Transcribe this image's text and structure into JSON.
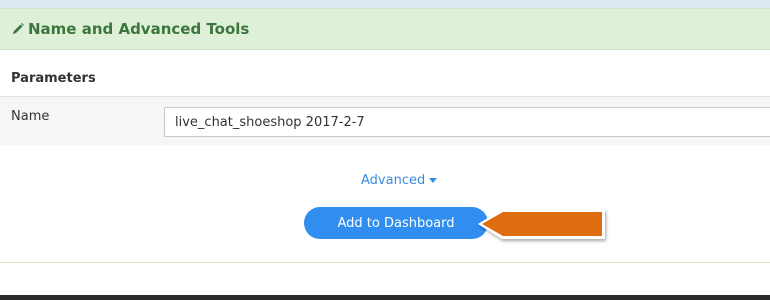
{
  "section": {
    "title": "Name and Advanced Tools",
    "icon": "pencil-icon"
  },
  "parameters": {
    "heading": "Parameters",
    "name_label": "Name",
    "name_value": "live_chat_shoeshop 2017-2-7"
  },
  "advanced": {
    "label": "Advanced",
    "icon": "caret-down-icon"
  },
  "actions": {
    "add_to_dashboard_label": "Add to Dashboard"
  },
  "colors": {
    "header_bg": "#dff0d8",
    "header_text": "#3c763d",
    "link": "#3a8be0",
    "primary_button": "#2f8ef0",
    "callout_arrow": "#e06c10"
  }
}
